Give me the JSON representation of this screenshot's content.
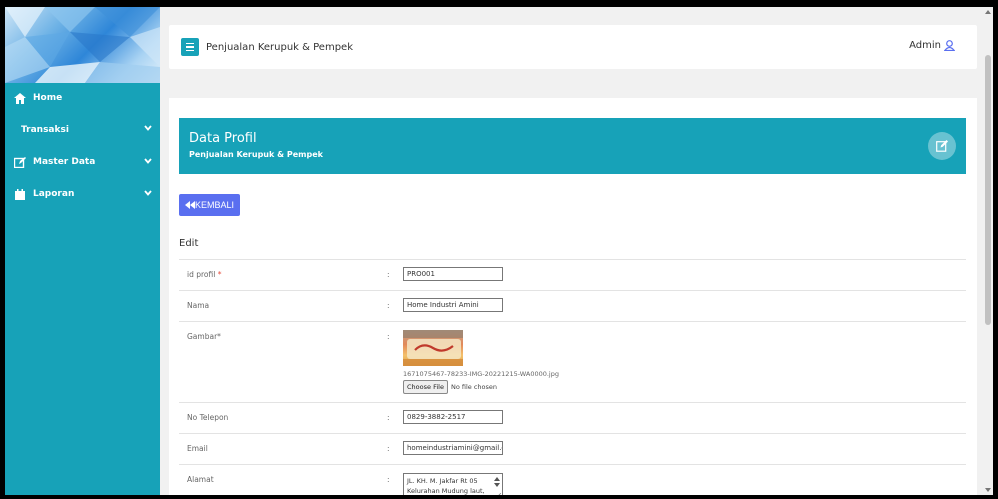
{
  "colors": {
    "accent": "#17a2b8",
    "back_button": "#5a6ff0",
    "required": "#e74c3c"
  },
  "sidebar": {
    "items": [
      {
        "label": "Home",
        "icon": "home-icon"
      },
      {
        "label": "Transaksi",
        "icon": "",
        "expandable": true
      },
      {
        "label": "Master Data",
        "icon": "edit-icon",
        "expandable": true
      },
      {
        "label": "Laporan",
        "icon": "calendar-icon",
        "expandable": true
      }
    ]
  },
  "header": {
    "app_title": "Penjualan Kerupuk & Pempek",
    "user": "Admin"
  },
  "card": {
    "title": "Data Profil",
    "subtitle": "Penjualan Kerupuk & Pempek",
    "back_label": "KEMBALI",
    "section_label": "Edit"
  },
  "form": {
    "id_profil": {
      "label": "id profil",
      "required_mark": "*",
      "value": "PRO001"
    },
    "nama": {
      "label": "Nama",
      "value": "Home Industri Amini"
    },
    "gambar": {
      "label": "Gambar*",
      "filename": "1671075467-78233-IMG-20221215-WA0000.jpg",
      "choose_label": "Choose File",
      "no_file": "No file chosen"
    },
    "telepon": {
      "label": "No Telepon",
      "value": "0829-3882-2517"
    },
    "email": {
      "label": "Email",
      "value": "homeindustriamini@gmail.c"
    },
    "alamat": {
      "label": "Alamat",
      "value": "JL. KH. M. Jakfar Rt 05 Kelurahan Mudung laut,"
    },
    "colon": ":"
  }
}
